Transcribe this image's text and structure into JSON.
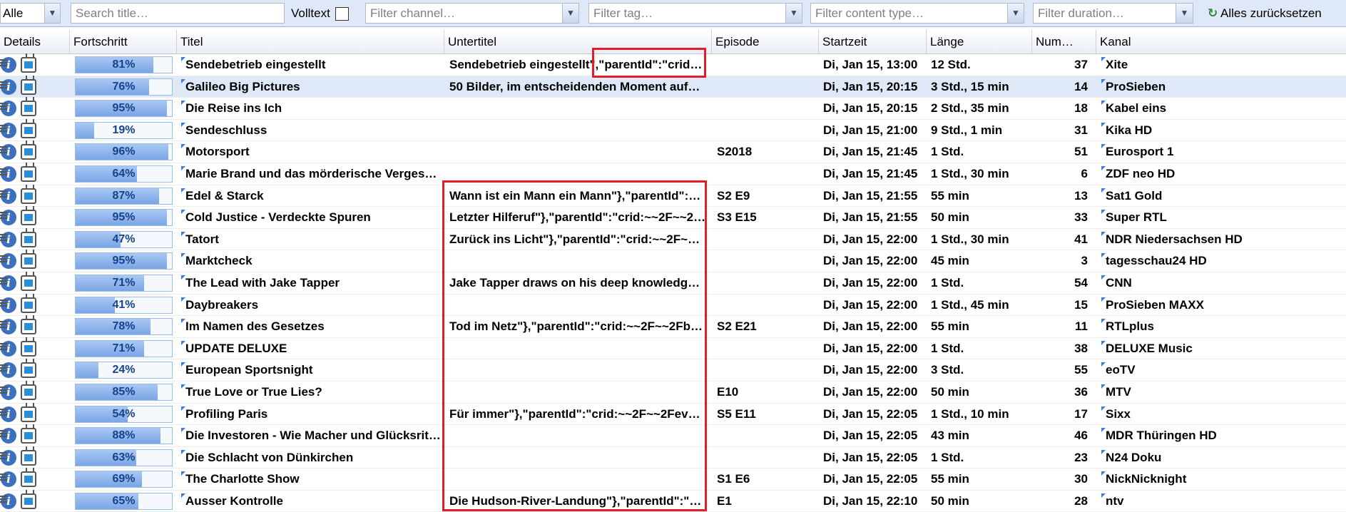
{
  "toolbar": {
    "mode_value": "Alle",
    "search_placeholder": "Search title…",
    "volltext_label": "Volltext",
    "channel_placeholder": "Filter channel…",
    "tag_placeholder": "Filter tag…",
    "content_type_placeholder": "Filter content type…",
    "duration_placeholder": "Filter duration…",
    "reset_label": "Alles zurücksetzen"
  },
  "columns": {
    "details": "Details",
    "progress": "Fortschritt",
    "title": "Titel",
    "subtitle": "Untertitel",
    "episode": "Episode",
    "start": "Startzeit",
    "length": "Länge",
    "number": "Num…",
    "channel": "Kanal"
  },
  "rows": [
    {
      "progress": "81%",
      "title": "Sendebetrieb eingestellt",
      "subtitle": "Sendebetrieb eingestellt\",\"parentId\":\"crid:…",
      "episode": "",
      "start": "Di, Jan 15, 13:00",
      "length": "12 Std.",
      "number": "37",
      "channel": "Xite"
    },
    {
      "progress": "76%",
      "title": "Galileo Big Pictures",
      "subtitle": "50 Bilder, im entscheidenden Moment aufg…",
      "episode": "",
      "start": "Di, Jan 15, 20:15",
      "length": "3 Std., 15 min",
      "number": "14",
      "channel": "ProSieben"
    },
    {
      "progress": "95%",
      "title": "Die Reise ins Ich",
      "subtitle": "",
      "episode": "",
      "start": "Di, Jan 15, 20:15",
      "length": "2 Std., 35 min",
      "number": "18",
      "channel": "Kabel eins"
    },
    {
      "progress": "19%",
      "title": "Sendeschluss",
      "subtitle": "",
      "episode": "",
      "start": "Di, Jan 15, 21:00",
      "length": "9 Std., 1 min",
      "number": "31",
      "channel": "Kika HD"
    },
    {
      "progress": "96%",
      "title": "Motorsport",
      "subtitle": "",
      "episode": "S2018",
      "start": "Di, Jan 15, 21:45",
      "length": "1 Std.",
      "number": "51",
      "channel": "Eurosport 1"
    },
    {
      "progress": "64%",
      "title": "Marie Brand und das mörderische Vergessen",
      "subtitle": "",
      "episode": "",
      "start": "Di, Jan 15, 21:45",
      "length": "1 Std., 30 min",
      "number": "6",
      "channel": "ZDF neo HD"
    },
    {
      "progress": "87%",
      "title": "Edel & Starck",
      "subtitle": "Wann ist ein Mann ein Mann\"},\"parentId\":\"c…",
      "episode": "S2 E9",
      "start": "Di, Jan 15, 21:55",
      "length": "55 min",
      "number": "13",
      "channel": "Sat1 Gold"
    },
    {
      "progress": "95%",
      "title": "Cold Justice - Verdeckte Spuren",
      "subtitle": "Letzter Hilferuf\"},\"parentId\":\"crid:~~2F~~2F…",
      "episode": "S3 E15",
      "start": "Di, Jan 15, 21:55",
      "length": "50 min",
      "number": "33",
      "channel": "Super RTL"
    },
    {
      "progress": "47%",
      "title": "Tatort",
      "subtitle": "Zurück ins Licht\"},\"parentId\":\"crid:~~2F~~2…",
      "episode": "",
      "start": "Di, Jan 15, 22:00",
      "length": "1 Std., 30 min",
      "number": "41",
      "channel": "NDR Niedersachsen HD"
    },
    {
      "progress": "95%",
      "title": "Marktcheck",
      "subtitle": "",
      "episode": "",
      "start": "Di, Jan 15, 22:00",
      "length": "45 min",
      "number": "3",
      "channel": "tagesschau24 HD"
    },
    {
      "progress": "71%",
      "title": "The Lead with Jake Tapper",
      "subtitle": "Jake Tapper draws on his deep knowledge …",
      "episode": "",
      "start": "Di, Jan 15, 22:00",
      "length": "1 Std.",
      "number": "54",
      "channel": "CNN"
    },
    {
      "progress": "41%",
      "title": "Daybreakers",
      "subtitle": "",
      "episode": "",
      "start": "Di, Jan 15, 22:00",
      "length": "1 Std., 45 min",
      "number": "15",
      "channel": "ProSieben MAXX"
    },
    {
      "progress": "78%",
      "title": "Im Namen des Gesetzes",
      "subtitle": "Tod im Netz\"},\"parentId\":\"crid:~~2F~~2Fbd…",
      "episode": "S2 E21",
      "start": "Di, Jan 15, 22:00",
      "length": "55 min",
      "number": "11",
      "channel": "RTLplus"
    },
    {
      "progress": "71%",
      "title": "UPDATE DELUXE",
      "subtitle": "",
      "episode": "",
      "start": "Di, Jan 15, 22:00",
      "length": "1 Std.",
      "number": "38",
      "channel": "DELUXE Music"
    },
    {
      "progress": "24%",
      "title": "European Sportsnight",
      "subtitle": "",
      "episode": "",
      "start": "Di, Jan 15, 22:00",
      "length": "3 Std.",
      "number": "55",
      "channel": "eoTV"
    },
    {
      "progress": "85%",
      "title": "True Love or True Lies?",
      "subtitle": "",
      "episode": "E10",
      "start": "Di, Jan 15, 22:00",
      "length": "50 min",
      "number": "36",
      "channel": "MTV"
    },
    {
      "progress": "54%",
      "title": "Profiling Paris",
      "subtitle": "Für immer\"},\"parentId\":\"crid:~~2F~~2Feve…",
      "episode": "S5 E11",
      "start": "Di, Jan 15, 22:05",
      "length": "1 Std., 10 min",
      "number": "17",
      "channel": "Sixx"
    },
    {
      "progress": "88%",
      "title": "Die Investoren - Wie Macher und Glücksritt…",
      "subtitle": "",
      "episode": "",
      "start": "Di, Jan 15, 22:05",
      "length": "43 min",
      "number": "46",
      "channel": "MDR Thüringen HD"
    },
    {
      "progress": "63%",
      "title": "Die Schlacht von Dünkirchen",
      "subtitle": "",
      "episode": "",
      "start": "Di, Jan 15, 22:05",
      "length": "1 Std.",
      "number": "23",
      "channel": "N24 Doku"
    },
    {
      "progress": "69%",
      "title": "The Charlotte Show",
      "subtitle": "",
      "episode": "S1 E6",
      "start": "Di, Jan 15, 22:05",
      "length": "55 min",
      "number": "30",
      "channel": "NickNicknight"
    },
    {
      "progress": "65%",
      "title": "Ausser Kontrolle",
      "subtitle": "Die Hudson-River-Landung\"},\"parentId\":\"cr…",
      "episode": "E1",
      "start": "Di, Jan 15, 22:10",
      "length": "50 min",
      "number": "28",
      "channel": "ntv"
    }
  ],
  "selected_row": 1,
  "colors": {
    "annotation": "#e11d2a",
    "selection": "#dfe8f6",
    "progress_fill": "#7ba5e5"
  }
}
